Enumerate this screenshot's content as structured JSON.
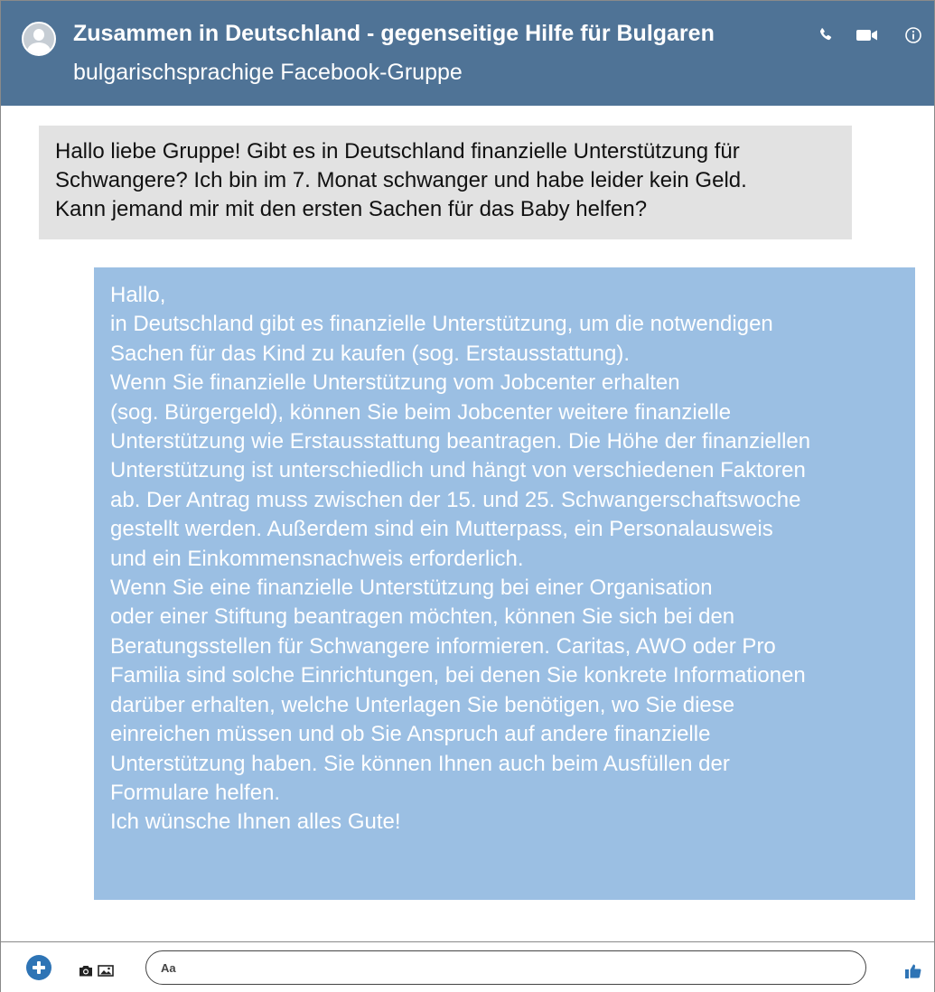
{
  "header": {
    "title": "Zusammen in Deutschland - gegenseitige Hilfe für Bulgaren",
    "subtitle": "bulgarischsprachige Facebook-Gruppe",
    "icons": [
      "phone-icon",
      "video-icon",
      "info-icon"
    ]
  },
  "messages": {
    "incoming": {
      "lines": [
        "Hallo liebe Gruppe! Gibt es in Deutschland finanzielle Unterstützung für",
        "Schwangere? Ich bin im 7. Monat schwanger und habe leider kein Geld.",
        "Kann jemand mir mit den ersten Sachen für das Baby helfen?"
      ]
    },
    "outgoing": {
      "lines": [
        "Hallo,",
        "in Deutschland gibt es finanzielle Unterstützung, um die notwendigen",
        "Sachen für das Kind zu kaufen (sog. Erstausstattung).",
        "Wenn Sie finanzielle Unterstützung vom Jobcenter erhalten",
        "(sog. Bürgergeld), können Sie beim Jobcenter weitere finanzielle",
        "Unterstützung wie Erstausstattung beantragen. Die Höhe der finanziellen",
        "Unterstützung ist unterschiedlich und hängt von verschiedenen Faktoren",
        "ab. Der Antrag muss zwischen der 15. und 25. Schwangerschaftswoche",
        "gestellt werden. Außerdem sind ein Mutterpass, ein Personalausweis",
        "und ein Einkommensnachweis erforderlich.",
        "Wenn Sie eine finanzielle Unterstützung bei einer Organisation",
        "oder einer Stiftung beantragen möchten, können Sie sich bei den",
        "Beratungsstellen für Schwangere informieren. Caritas, AWO oder Pro",
        "Familia sind solche Einrichtungen, bei denen Sie konkrete Informationen",
        "darüber erhalten, welche Unterlagen Sie benötigen, wo Sie diese",
        "einreichen müssen und ob Sie Anspruch auf andere finanzielle",
        "Unterstützung haben. Sie können Ihnen auch beim Ausfüllen der",
        "Formulare helfen.",
        "Ich wünsche Ihnen alles Gute!"
      ]
    }
  },
  "composer": {
    "placeholder": "Aa",
    "icons": [
      "plus-icon",
      "camera-icon",
      "photo-icon",
      "like-icon"
    ]
  },
  "colors": {
    "header_bg": "#4f7396",
    "incoming_bg": "#e2e2e2",
    "outgoing_bg": "#9bbfe3",
    "accent": "#2e74b5"
  }
}
